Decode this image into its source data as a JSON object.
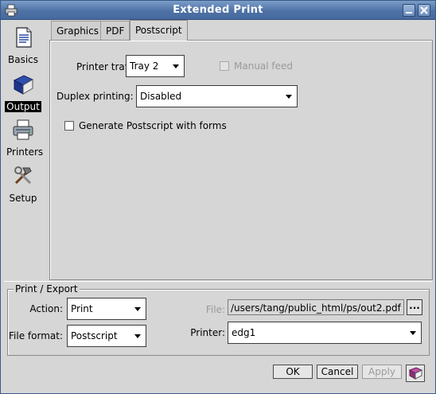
{
  "window": {
    "title": "Extended Print"
  },
  "icons": {
    "window": "printer-icon",
    "minimize": "minimize-icon",
    "close": "close-icon",
    "help": "help-book-icon"
  },
  "nav": {
    "items": [
      {
        "label": "Basics",
        "icon": "document-icon",
        "selected": false
      },
      {
        "label": "Output",
        "icon": "book-icon",
        "selected": true
      },
      {
        "label": "Printers",
        "icon": "printer-icon",
        "selected": false
      },
      {
        "label": "Setup",
        "icon": "tools-icon",
        "selected": false
      }
    ]
  },
  "tabs": [
    {
      "label": "Graphics",
      "active": false
    },
    {
      "label": "PDF",
      "active": false
    },
    {
      "label": "Postscript",
      "active": true
    }
  ],
  "postscript": {
    "printer_tray_label": "Printer tray:",
    "printer_tray_value": "Tray 2",
    "manual_feed_label": "Manual feed",
    "manual_feed_checked": false,
    "duplex_label": "Duplex printing:",
    "duplex_value": "Disabled",
    "forms_label": "Generate Postscript with forms",
    "forms_checked": false
  },
  "export": {
    "group_title": "Print / Export",
    "action_label": "Action:",
    "action_value": "Print",
    "file_format_label": "File format:",
    "file_format_value": "Postscript",
    "file_label": "File:",
    "file_value": "/users/tang/public_html/ps/out2.pdf",
    "browse_label": "...",
    "printer_label": "Printer:",
    "printer_value": "edg1"
  },
  "buttons": {
    "ok": "OK",
    "cancel": "Cancel",
    "apply": "Apply"
  }
}
